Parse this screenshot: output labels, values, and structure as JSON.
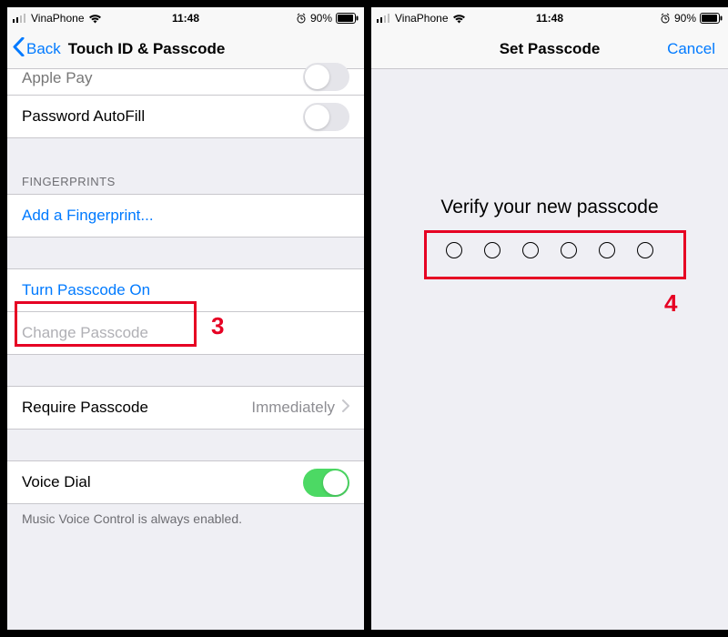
{
  "status": {
    "carrier": "VinaPhone",
    "time": "11:48",
    "battery": "90%"
  },
  "left": {
    "nav_back": "Back",
    "nav_title": "Touch ID & Passcode",
    "rows": {
      "apple_pay": "Apple Pay",
      "password_autofill": "Password AutoFill",
      "fingerprints_header": "FINGERPRINTS",
      "add_fingerprint": "Add a Fingerprint...",
      "turn_passcode_on": "Turn Passcode On",
      "change_passcode": "Change Passcode",
      "require_passcode": "Require Passcode",
      "require_passcode_value": "Immediately",
      "voice_dial": "Voice Dial"
    },
    "footer": "Music Voice Control is always enabled.",
    "step": "3"
  },
  "right": {
    "nav_title": "Set Passcode",
    "nav_cancel": "Cancel",
    "verify_title": "Verify your new passcode",
    "step": "4"
  }
}
